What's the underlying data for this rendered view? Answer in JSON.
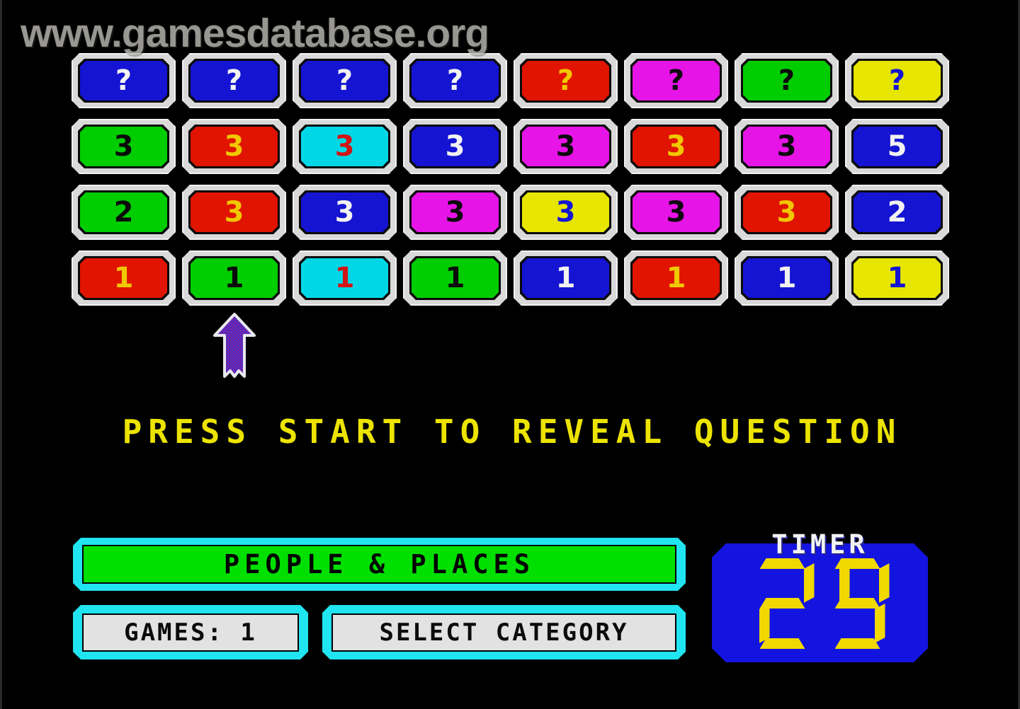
{
  "watermark": "www.gamesdatabase.org",
  "prompt": "PRESS START TO REVEAL QUESTION",
  "category": {
    "label": "PEOPLE & PLACES",
    "bg_color": "#00e000",
    "frame_color": "#20e4f0"
  },
  "games": {
    "label": "GAMES:  1",
    "count": "1"
  },
  "select_category": {
    "label": "SELECT CATEGORY"
  },
  "timer": {
    "title": "TIMER",
    "value": "29",
    "digit_color": "#f0d800",
    "panel_color": "#1414e0"
  },
  "cursor": {
    "icon": "up-arrow-cursor",
    "column_index": 1
  },
  "board": {
    "rows": 4,
    "columns": 8,
    "tiles": [
      [
        {
          "text": "?",
          "bg": "#1414d2",
          "fg": "#f2f2f2"
        },
        {
          "text": "?",
          "bg": "#1414d2",
          "fg": "#f2f2f2"
        },
        {
          "text": "?",
          "bg": "#1414d2",
          "fg": "#f2f2f2"
        },
        {
          "text": "?",
          "bg": "#1414d2",
          "fg": "#f2f2f2"
        },
        {
          "text": "?",
          "bg": "#e01400",
          "fg": "#f0c800"
        },
        {
          "text": "?",
          "bg": "#e614e6",
          "fg": "#0a0a0a"
        },
        {
          "text": "?",
          "bg": "#00cd00",
          "fg": "#0a0a0a"
        },
        {
          "text": "?",
          "bg": "#e6e600",
          "fg": "#1414d2"
        }
      ],
      [
        {
          "text": "3",
          "bg": "#00cd00",
          "fg": "#0a0a0a"
        },
        {
          "text": "3",
          "bg": "#e01400",
          "fg": "#f0c800"
        },
        {
          "text": "3",
          "bg": "#00d7e6",
          "fg": "#d21414"
        },
        {
          "text": "3",
          "bg": "#1414d2",
          "fg": "#f2f2f2"
        },
        {
          "text": "3",
          "bg": "#e614e6",
          "fg": "#0a0a0a"
        },
        {
          "text": "3",
          "bg": "#e01400",
          "fg": "#f0c800"
        },
        {
          "text": "3",
          "bg": "#e614e6",
          "fg": "#0a0a0a"
        },
        {
          "text": "5",
          "bg": "#1414d2",
          "fg": "#f2f2f2"
        }
      ],
      [
        {
          "text": "2",
          "bg": "#00cd00",
          "fg": "#0a0a0a"
        },
        {
          "text": "3",
          "bg": "#e01400",
          "fg": "#f0c800"
        },
        {
          "text": "3",
          "bg": "#1414d2",
          "fg": "#f2f2f2"
        },
        {
          "text": "3",
          "bg": "#e614e6",
          "fg": "#0a0a0a"
        },
        {
          "text": "3",
          "bg": "#e6e600",
          "fg": "#1414d2"
        },
        {
          "text": "3",
          "bg": "#e614e6",
          "fg": "#0a0a0a"
        },
        {
          "text": "3",
          "bg": "#e01400",
          "fg": "#f0c800"
        },
        {
          "text": "2",
          "bg": "#1414d2",
          "fg": "#f2f2f2"
        }
      ],
      [
        {
          "text": "1",
          "bg": "#e01400",
          "fg": "#f0c800"
        },
        {
          "text": "1",
          "bg": "#00cd00",
          "fg": "#0a0a0a"
        },
        {
          "text": "1",
          "bg": "#00d7e6",
          "fg": "#d21414"
        },
        {
          "text": "1",
          "bg": "#00cd00",
          "fg": "#0a0a0a"
        },
        {
          "text": "1",
          "bg": "#1414d2",
          "fg": "#f2f2f2"
        },
        {
          "text": "1",
          "bg": "#e01400",
          "fg": "#f0c800"
        },
        {
          "text": "1",
          "bg": "#1414d2",
          "fg": "#f2f2f2"
        },
        {
          "text": "1",
          "bg": "#e6e600",
          "fg": "#1414d2"
        }
      ]
    ]
  }
}
